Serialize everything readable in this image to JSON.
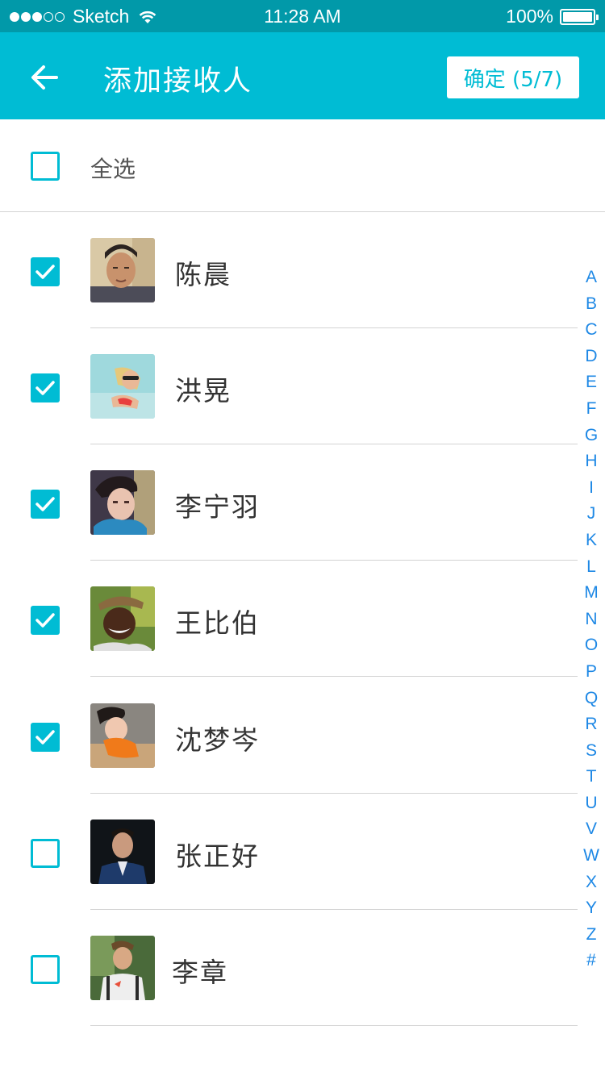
{
  "status_bar": {
    "carrier": "Sketch",
    "time": "11:28 AM",
    "battery": "100%"
  },
  "nav": {
    "title": "添加接收人",
    "confirm_label": "确定 (5/7)"
  },
  "select_all": {
    "label": "全选",
    "checked": false
  },
  "contacts": [
    {
      "name": "陈晨",
      "checked": true
    },
    {
      "name": "洪晃",
      "checked": true
    },
    {
      "name": "李宁羽",
      "checked": true
    },
    {
      "name": "王比伯",
      "checked": true
    },
    {
      "name": "沈梦岑",
      "checked": true
    },
    {
      "name": "张正好",
      "checked": false
    },
    {
      "name": "李章",
      "checked": false
    }
  ],
  "alphabet": [
    "A",
    "B",
    "C",
    "D",
    "E",
    "F",
    "G",
    "H",
    "I",
    "J",
    "K",
    "L",
    "M",
    "N",
    "O",
    "P",
    "Q",
    "R",
    "S",
    "T",
    "U",
    "V",
    "W",
    "X",
    "Y",
    "Z",
    "#"
  ],
  "colors": {
    "accent": "#00bcd4",
    "status_bar": "#0199a9",
    "index_letter": "#1e88e5",
    "divider": "#d3d3d3"
  }
}
